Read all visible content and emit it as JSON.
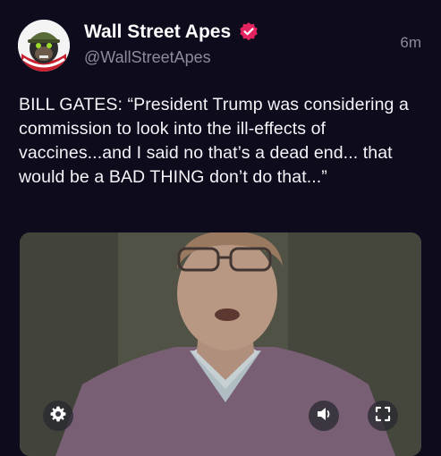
{
  "post": {
    "author": {
      "display_name": "Wall Street Apes",
      "handle": "@WallStreetApes",
      "verified_icon": "verified-badge-icon",
      "avatar_icon": "ape-avatar"
    },
    "timestamp": "6m",
    "text": "BILL GATES: “President Trump was considering a commission to look into the ill-effects of vaccines...and I said no that’s a dead end... that would be a BAD THING don’t do that...”",
    "media": {
      "type": "video",
      "controls": {
        "settings_icon": "gear-icon",
        "volume_icon": "speaker-icon",
        "fullscreen_icon": "fullscreen-icon"
      }
    }
  },
  "colors": {
    "background": "#0d0b1c",
    "verified_badge": "#e3245f",
    "secondary_text": "#8c8a9c"
  }
}
